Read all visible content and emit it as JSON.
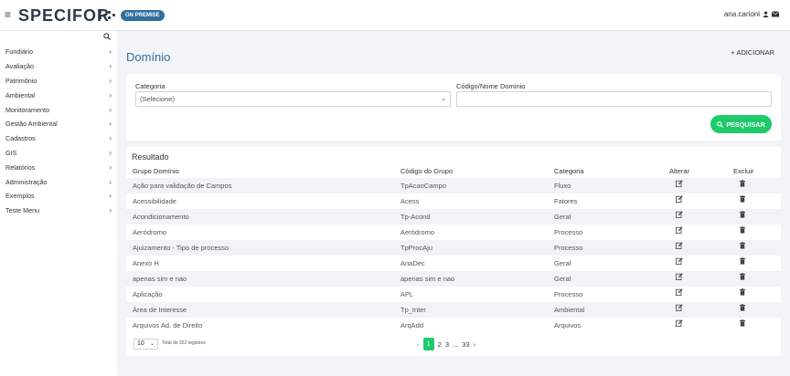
{
  "header": {
    "menu_icon": "hamburger-icon",
    "brand": "SPECIFOR",
    "badge": "ON PREMISE",
    "user_name": "ana.carioni",
    "user_icon": "user-icon",
    "mail_icon": "envelope-icon"
  },
  "sidebar": {
    "search_icon": "search-icon",
    "items": [
      {
        "label": "Fundiário"
      },
      {
        "label": "Avaliação"
      },
      {
        "label": "Patrimônio"
      },
      {
        "label": "Ambiental"
      },
      {
        "label": "Monitoramento"
      },
      {
        "label": "Gestão Ambiental"
      },
      {
        "label": "Cadastros"
      },
      {
        "label": "GIS"
      },
      {
        "label": "Relatórios"
      },
      {
        "label": "Administração"
      },
      {
        "label": "Exemplos"
      },
      {
        "label": "Teste Menu"
      }
    ]
  },
  "page": {
    "title": "Domínio",
    "add_label": "+ ADICIONAR"
  },
  "filters": {
    "category_label": "Categoria",
    "category_value": "(Selecione)",
    "code_label": "Código/Nome Dominio",
    "code_value": "",
    "search_label": "PESQUISAR"
  },
  "results": {
    "title": "Resultado",
    "columns": [
      "Grupo Domínio",
      "Código do Grupo",
      "Categoria",
      "Alterar",
      "Excluir"
    ],
    "rows": [
      {
        "grupo": "Ação para validação de Campos",
        "codigo": "TpAcaoCampo",
        "categoria": "Fluxo"
      },
      {
        "grupo": "Acessibilidade",
        "codigo": "Acess",
        "categoria": "Fatores"
      },
      {
        "grupo": "Acondicionamento",
        "codigo": "Tp-Acond",
        "categoria": "Geral"
      },
      {
        "grupo": "Aeródromo",
        "codigo": "Aeródromo",
        "categoria": "Processo"
      },
      {
        "grupo": "Ajuizamento - Tipo de processo",
        "codigo": "TpProcAju",
        "categoria": "Processo"
      },
      {
        "grupo": "Anexo H",
        "codigo": "AnaDec",
        "categoria": "Geral"
      },
      {
        "grupo": "apenas sim e nao",
        "codigo": "apenas sim e nao",
        "categoria": "Geral"
      },
      {
        "grupo": "Aplicação",
        "codigo": "APL",
        "categoria": "Processo"
      },
      {
        "grupo": "Área de Interesse",
        "codigo": "Tp_Inter",
        "categoria": "Ambiental"
      },
      {
        "grupo": "Arquivos Ad. de Direito",
        "codigo": "ArqAdd",
        "categoria": "Arquivos"
      }
    ],
    "page_size": "10",
    "total_text": "Total de 322 registros",
    "pages": [
      "1",
      "2",
      "3",
      "...",
      "33"
    ],
    "current_page": "1"
  },
  "colors": {
    "primary": "#2f6e9e",
    "success": "#1fca6b"
  }
}
